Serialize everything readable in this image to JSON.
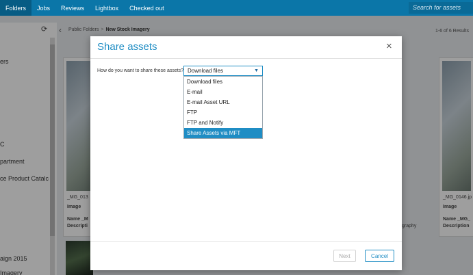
{
  "nav": {
    "tabs": [
      "Folders",
      "Jobs",
      "Reviews",
      "Lightbox",
      "Checked out"
    ],
    "search_placeholder": "Search for assets"
  },
  "sidebar": {
    "items": [
      "ers",
      "C",
      "partment",
      "ce Product Catalc",
      "aign 2015",
      "Imagery"
    ]
  },
  "breadcrumb": {
    "parent": "Public Folders",
    "separator": ">",
    "current": "New Stock Imagery"
  },
  "results": "1-6 of 6 Results",
  "cards": {
    "left": {
      "filename": "_MG_013",
      "type": "Image",
      "name": "Name _M",
      "description": "Descripti"
    },
    "right": {
      "filename": "_MG_0146.jp",
      "type": "Image",
      "name": "Name _MG_",
      "description": "Description"
    },
    "middle_text": "graphy"
  },
  "modal": {
    "title": "Share assets",
    "close": "×",
    "question": "How do you want to share these assets?",
    "selected": "Download files",
    "options": [
      "Download files",
      "E-mail",
      "E-mail Asset URL",
      "FTP",
      "FTP and Notify",
      "Share Assets via MFT"
    ],
    "highlighted_index": 5,
    "next_label": "Next",
    "cancel_label": "Cancel"
  },
  "colors": {
    "nav": "#0b76a8",
    "accent": "#1f8dc4"
  }
}
